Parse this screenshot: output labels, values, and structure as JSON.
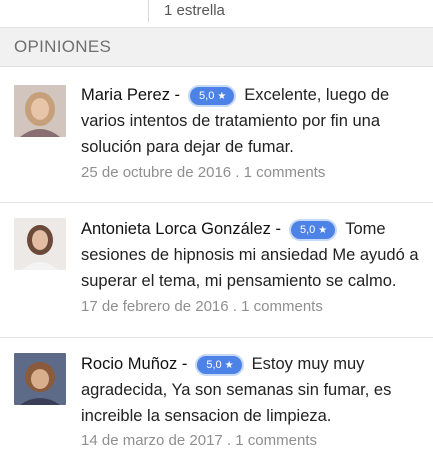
{
  "rating_filter": {
    "label": "1 estrella"
  },
  "section": {
    "title": "OPINIONES"
  },
  "reviews": [
    {
      "name": "Maria Perez -",
      "rating": "5,0",
      "text": "Excelente, luego de varios intentos de tratamiento por fin una solución para dejar de fumar.",
      "date": "25 de octubre de 2016",
      "separator": " . ",
      "comments": "1 comments"
    },
    {
      "name": "Antonieta Lorca González -",
      "rating": "5,0",
      "text": "Tome sesiones de hipnosis mi ansiedad Me ayudó a superar el tema, mi pensamiento se calmo.",
      "date": "17 de febrero de 2016",
      "separator": " . ",
      "comments": "1 comments"
    },
    {
      "name": "Rocio Muñoz -",
      "rating": "5,0",
      "text": "Estoy muy muy agradecida, Ya son semanas sin fumar, es increible la sensacion de limpieza.",
      "date": "14 de marzo de 2017",
      "separator": " . ",
      "comments": "1 comments"
    }
  ],
  "colors": {
    "badge": "#4d83e6",
    "header_bg": "#f1f1f1",
    "meta_text": "#8f8f8f"
  },
  "icons": {
    "badge_star": "star-icon"
  }
}
